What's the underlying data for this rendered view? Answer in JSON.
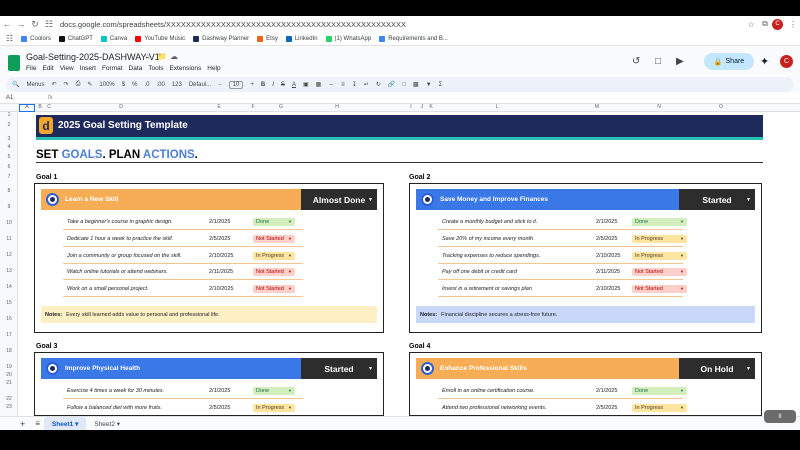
{
  "browser": {
    "url": "docs.google.com/spreadsheets/XXXXXXXXXXXXXXXXXXXXXXXXXXXXXXXXXXXXXXXXXXXXXXXX",
    "avatar_letter": "C"
  },
  "bookmarks": [
    {
      "label": "Coolors",
      "color": "#4285f4"
    },
    {
      "label": "ChatGPT",
      "color": "#111111"
    },
    {
      "label": "Canva",
      "color": "#00c4cc"
    },
    {
      "label": "YouTube Music",
      "color": "#ff0000"
    },
    {
      "label": "Dashway Planner",
      "color": "#1f2a5c"
    },
    {
      "label": "Etsy",
      "color": "#f1641e"
    },
    {
      "label": "LinkedIn",
      "color": "#0a66c2"
    },
    {
      "label": "(1) WhatsApp",
      "color": "#25d366"
    },
    {
      "label": "Requirements and B...",
      "color": "#4285f4"
    }
  ],
  "doc": {
    "title": "Goal-Setting-2025-DASHWAY-V1",
    "menus": [
      "File",
      "Edit",
      "View",
      "Insert",
      "Format",
      "Data",
      "Tools",
      "Extensions",
      "Help"
    ],
    "share_label": "Share"
  },
  "toolbar": {
    "menus_label": "Menus",
    "zoom": "100%",
    "currency": "$",
    "percent": "%",
    "dec1": ".0",
    "dec2": ".00",
    "num": "123",
    "font": "Defaul...",
    "font_size": "10"
  },
  "cell_ref": "A1",
  "columns": [
    "A",
    "B",
    "C",
    "D",
    "E",
    "F",
    "G",
    "H",
    "I",
    "J",
    "K",
    "L",
    "M",
    "N",
    "O"
  ],
  "rows": [
    "1",
    "2",
    "3",
    "4",
    "5",
    "6",
    "7",
    "8",
    "9",
    "10",
    "11",
    "12",
    "13",
    "14",
    "15",
    "16",
    "17",
    "18",
    "19",
    "20",
    "21",
    "22",
    "23"
  ],
  "sheet": {
    "banner_title": "2025 Goal Setting Template",
    "banner_logo": "d",
    "tagline": {
      "p1": "SET ",
      "p2": "GOALS",
      "p3": ". PLAN ",
      "p4": "ACTIONS",
      "p5": "."
    }
  },
  "goals": [
    {
      "label": "Goal 1",
      "title": "Learn a New Skill",
      "status": "Almost Done",
      "head_color": "#f6ad55",
      "notes_bg": "#fdf0c4",
      "tasks": [
        {
          "text": "Take a beginner's course in graphic design.",
          "date": "2/1/2025",
          "status": "Done"
        },
        {
          "text": "Dedicate 1 hour a week to practice the skill.",
          "date": "2/5/2025",
          "status": "Not Started"
        },
        {
          "text": "Join a community or group focused on the skill.",
          "date": "2/10/2025",
          "status": "In Progress"
        },
        {
          "text": "Watch online tutorials or attend webinars.",
          "date": "2/11/2025",
          "status": "Not Started"
        },
        {
          "text": "Work on a small personal project.",
          "date": "2/10/2025",
          "status": "Not Started"
        }
      ],
      "notes_label": "Notes:",
      "notes": "Every skill learned adds value to personal and professional life."
    },
    {
      "label": "Goal 2",
      "title": "Save Money and Improve Finances",
      "status": "Started",
      "head_color": "#3b78e7",
      "notes_bg": "#c9d7f8",
      "tasks": [
        {
          "text": "Create a monthly budget and stick to it.",
          "date": "2/1/2025",
          "status": "Done"
        },
        {
          "text": "Save 20% of my income every month",
          "date": "2/5/2025",
          "status": "In Progress"
        },
        {
          "text": "Tracking expenses to reduce spendings.",
          "date": "2/10/2025",
          "status": "In Progress"
        },
        {
          "text": "Pay off one debit or credit card",
          "date": "2/11/2025",
          "status": "Not Started"
        },
        {
          "text": "Invest in a retirement or savings plan",
          "date": "2/10/2025",
          "status": "Not Started"
        }
      ],
      "notes_label": "Notes:",
      "notes": "Financial discipline secures a stress-free future."
    },
    {
      "label": "Goal 3",
      "title": "Improve Physical Health",
      "status": "Started",
      "head_color": "#3b78e7",
      "tasks": [
        {
          "text": "Exercise 4 times a week for 30 minutes.",
          "date": "2/1/2025",
          "status": "Done"
        },
        {
          "text": "Follow a balanced diet with more fruits.",
          "date": "2/5/2025",
          "status": "In Progress"
        }
      ]
    },
    {
      "label": "Goal 4",
      "title": "Enhance Professional Skills",
      "status": "On Hold",
      "head_color": "#f6ad55",
      "tasks": [
        {
          "text": "Enroll in an online certification course.",
          "date": "2/1/2025",
          "status": "Done"
        },
        {
          "text": "Attend two professional networking events.",
          "date": "2/5/2025",
          "status": "In Progress"
        }
      ]
    }
  ],
  "status_colors": {
    "Done": {
      "bg": "#d4edbc",
      "fg": "#11734b"
    },
    "Not Started": {
      "bg": "#ffcfc9",
      "fg": "#b10202"
    },
    "In Progress": {
      "bg": "#ffe5a0",
      "fg": "#473821"
    }
  },
  "tabs": [
    "Sheet1",
    "Sheet2"
  ],
  "overlay_pause": "II"
}
